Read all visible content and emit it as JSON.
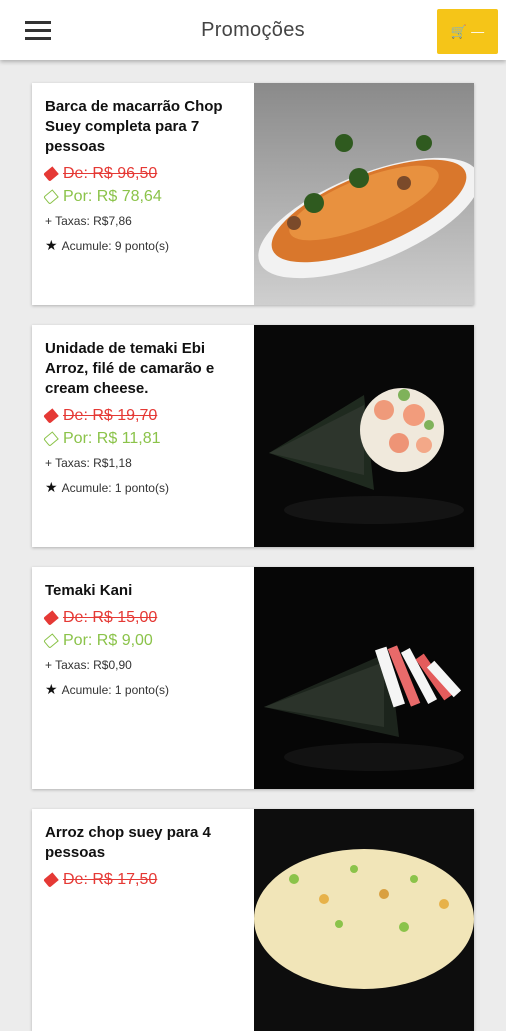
{
  "appbar": {
    "title": "Promoções",
    "menu_icon": "hamburger-icon",
    "cart_icon": "cart-icon",
    "cart_count": "—"
  },
  "products": [
    {
      "name": "Barca de macarrão Chop Suey completa para 7 pessoas",
      "old_price": "De: R$ 96,50",
      "new_price": "Por: R$ 78,64",
      "taxes": "+ Taxas: R$7,86",
      "points": "Acumule: 9 ponto(s)"
    },
    {
      "name": "Unidade de temaki Ebi Arroz, filé de camarão e cream cheese.",
      "old_price": "De: R$ 19,70",
      "new_price": "Por: R$ 11,81",
      "taxes": "+ Taxas: R$1,18",
      "points": "Acumule: 1 ponto(s)"
    },
    {
      "name": "Temaki Kani",
      "old_price": "De: R$ 15,00",
      "new_price": "Por: R$ 9,00",
      "taxes": "+ Taxas: R$0,90",
      "points": "Acumule: 1 ponto(s)"
    },
    {
      "name": "Arroz chop suey para 4 pessoas",
      "old_price": "De: R$ 17,50",
      "new_price": "",
      "taxes": "",
      "points": ""
    }
  ],
  "colors": {
    "accent": "#f5c518",
    "old_price": "#e53935",
    "new_price": "#8bc34a"
  }
}
